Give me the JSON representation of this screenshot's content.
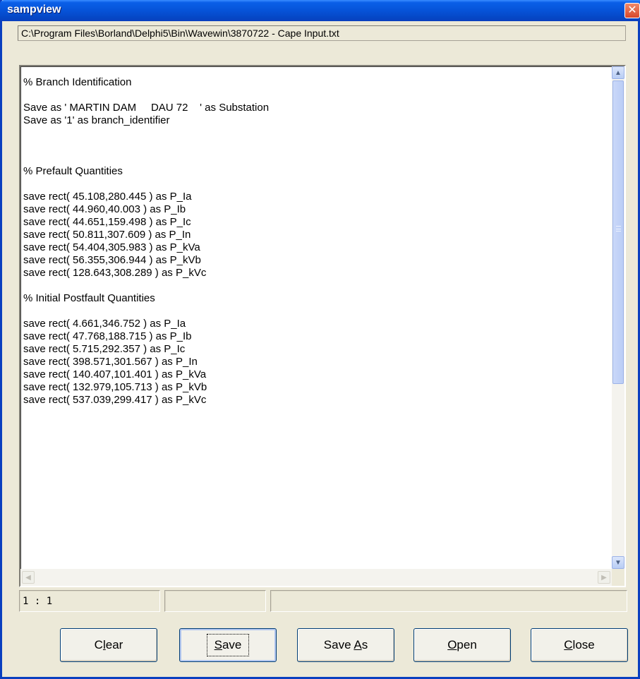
{
  "window": {
    "title": "sampview"
  },
  "path": "C:\\Program Files\\Borland\\Delphi5\\Bin\\Wavewin\\3870722 - Cape Input.txt",
  "memo": {
    "lines": [
      "",
      "% Branch Identification",
      "",
      "Save as ' MARTIN DAM     DAU 72    ' as Substation",
      "Save as '1' as branch_identifier",
      "",
      "",
      "",
      "% Prefault Quantities",
      "",
      "save rect( 45.108,280.445 ) as P_Ia",
      "save rect( 44.960,40.003 ) as P_Ib",
      "save rect( 44.651,159.498 ) as P_Ic",
      "save rect( 50.811,307.609 ) as P_In",
      "save rect( 54.404,305.983 ) as P_kVa",
      "save rect( 56.355,306.944 ) as P_kVb",
      "save rect( 128.643,308.289 ) as P_kVc",
      "",
      "% Initial Postfault Quantities",
      "",
      "save rect( 4.661,346.752 ) as P_Ia",
      "save rect( 47.768,188.715 ) as P_Ib",
      "save rect( 5.715,292.357 ) as P_Ic",
      "save rect( 398.571,301.567 ) as P_In",
      "save rect( 140.407,101.401 ) as P_kVa",
      "save rect( 132.979,105.713 ) as P_kVb",
      "save rect( 537.039,299.417 ) as P_kVc"
    ],
    "scroll_position": 0.25
  },
  "status": {
    "position": "1 : 1",
    "panel2": "",
    "panel3": ""
  },
  "buttons": {
    "clear": {
      "pre": "C",
      "mnemonic": "l",
      "post": "ear"
    },
    "save": {
      "pre": "",
      "mnemonic": "S",
      "post": "ave"
    },
    "save_as": {
      "pre": "Save ",
      "mnemonic": "A",
      "post": "s"
    },
    "open": {
      "pre": "",
      "mnemonic": "O",
      "post": "pen"
    },
    "close": {
      "pre": "",
      "mnemonic": "C",
      "post": "lose"
    }
  },
  "icons": {
    "close": "close-icon",
    "scroll_up": "arrow-up-icon",
    "scroll_down": "arrow-down-icon",
    "scroll_left": "arrow-left-icon",
    "scroll_right": "arrow-right-icon"
  },
  "colors": {
    "title_bar": "#0653d8",
    "close_button": "#d8472a",
    "window_face": "#ece9d8"
  }
}
